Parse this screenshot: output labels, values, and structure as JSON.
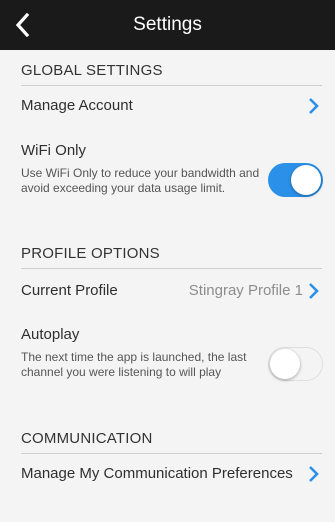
{
  "header": {
    "title": "Settings",
    "back_icon": "chevron-left-icon"
  },
  "sections": {
    "global": {
      "title": "GLOBAL SETTINGS",
      "manage_account": "Manage Account",
      "wifi_only": {
        "label": "WiFi Only",
        "description": "Use WiFi Only to reduce your bandwidth and avoid exceeding your data usage limit.",
        "enabled": true
      }
    },
    "profile": {
      "title": "PROFILE OPTIONS",
      "current_profile": {
        "label": "Current Profile",
        "value": "Stingray Profile 1"
      },
      "autoplay": {
        "label": "Autoplay",
        "description": "The next time the app is launched, the last channel you were listening to will play",
        "enabled": false
      }
    },
    "communication": {
      "title": "COMMUNICATION",
      "manage_preferences": "Manage My Communication Preferences"
    }
  },
  "colors": {
    "accent": "#2a90e8",
    "header_bg": "#1a1a1a",
    "page_bg": "#f4f4f4"
  }
}
